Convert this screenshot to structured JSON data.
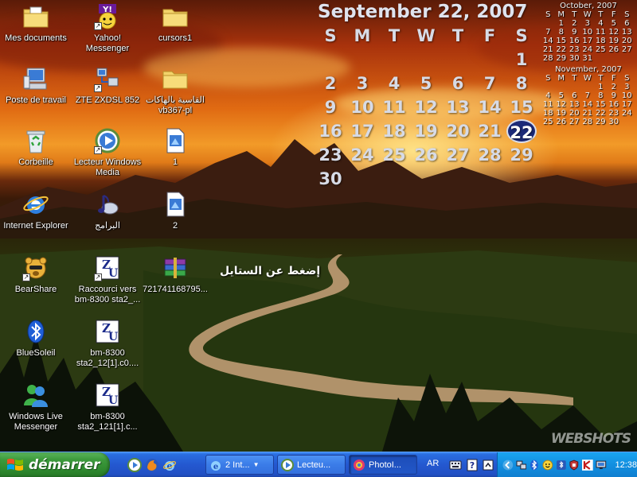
{
  "desktop_icons": [
    {
      "label": "Mes documents",
      "icon": "folder-documents-icon"
    },
    {
      "label": "Poste de travail",
      "icon": "computer-icon"
    },
    {
      "label": "Corbeille",
      "icon": "recycle-bin-icon"
    },
    {
      "label": "Internet Explorer",
      "icon": "internet-explorer-icon"
    },
    {
      "label": "BearShare",
      "icon": "bearshare-icon"
    },
    {
      "label": "BlueSoleil",
      "icon": "bluetooth-icon"
    },
    {
      "label": "Windows Live Messenger",
      "icon": "messenger-icon"
    },
    {
      "label": "Yahoo! Messenger",
      "icon": "yahoo-messenger-icon"
    },
    {
      "label": "ZTE ZXDSL 852",
      "icon": "network-shortcut-icon"
    },
    {
      "label": "Lecteur Windows Media",
      "icon": "media-player-icon"
    },
    {
      "label": "البرامج",
      "icon": "music-note-icon"
    },
    {
      "label": "Raccourci vers bm-8300 sta2_...",
      "icon": "zu-document-icon"
    },
    {
      "label": "bm-8300 sta2_12[1].c0....",
      "icon": "zu-document-icon"
    },
    {
      "label": "bm-8300 sta2_121[1].c...",
      "icon": "zu-document-icon"
    },
    {
      "label": "cursors1",
      "icon": "folder-icon"
    },
    {
      "label": "القاسية بالهاكات vb367-pl",
      "icon": "folder-icon"
    },
    {
      "label": "1",
      "icon": "html-file-icon"
    },
    {
      "label": "2",
      "icon": "html-file-icon"
    },
    {
      "label": "721741168795...",
      "icon": "winrar-archive-icon"
    }
  ],
  "calendar": {
    "title": "September 22, 2007",
    "weekdays": [
      "S",
      "M",
      "T",
      "W",
      "T",
      "F",
      "S"
    ],
    "weeks": [
      [
        "",
        "",
        "",
        "",
        "",
        "",
        "1"
      ],
      [
        "2",
        "3",
        "4",
        "5",
        "6",
        "7",
        "8"
      ],
      [
        "9",
        "10",
        "11",
        "12",
        "13",
        "14",
        "15"
      ],
      [
        "16",
        "17",
        "18",
        "19",
        "20",
        "21",
        "22"
      ],
      [
        "23",
        "24",
        "25",
        "26",
        "27",
        "28",
        "29"
      ],
      [
        "30",
        "",
        "",
        "",
        "",
        "",
        ""
      ]
    ],
    "today": "22"
  },
  "mini_calendars": [
    {
      "title": "October, 2007",
      "weekdays": [
        "S",
        "M",
        "T",
        "W",
        "T",
        "F",
        "S"
      ],
      "weeks": [
        [
          "",
          "1",
          "2",
          "3",
          "4",
          "5",
          "6"
        ],
        [
          "7",
          "8",
          "9",
          "10",
          "11",
          "12",
          "13"
        ],
        [
          "14",
          "15",
          "16",
          "17",
          "18",
          "19",
          "20"
        ],
        [
          "21",
          "22",
          "23",
          "24",
          "25",
          "26",
          "27"
        ],
        [
          "28",
          "29",
          "30",
          "31",
          "",
          "",
          ""
        ]
      ]
    },
    {
      "title": "November, 2007",
      "weekdays": [
        "S",
        "M",
        "T",
        "W",
        "T",
        "F",
        "S"
      ],
      "weeks": [
        [
          "",
          "",
          "",
          "",
          "1",
          "2",
          "3"
        ],
        [
          "4",
          "5",
          "6",
          "7",
          "8",
          "9",
          "10"
        ],
        [
          "11",
          "12",
          "13",
          "14",
          "15",
          "16",
          "17"
        ],
        [
          "18",
          "19",
          "20",
          "21",
          "22",
          "23",
          "24"
        ],
        [
          "25",
          "26",
          "27",
          "28",
          "29",
          "30",
          ""
        ]
      ]
    }
  ],
  "float_text": "إضغط عن الستايل",
  "watermark": "WEBSHOTS",
  "taskbar": {
    "start_label": "démarrer",
    "quick_launch": [
      "media-player-icon",
      "firefox-icon",
      "internet-explorer-icon"
    ],
    "tasks": [
      {
        "label": "2 Int...",
        "icon": "internet-explorer-icon",
        "grouped": true,
        "active": false
      },
      {
        "label": "Lecteu...",
        "icon": "media-player-icon",
        "grouped": false,
        "active": false
      },
      {
        "label": "PhotoI...",
        "icon": "photo-impact-icon",
        "grouped": false,
        "active": true
      }
    ],
    "language": "AR",
    "clock": "12:38"
  }
}
